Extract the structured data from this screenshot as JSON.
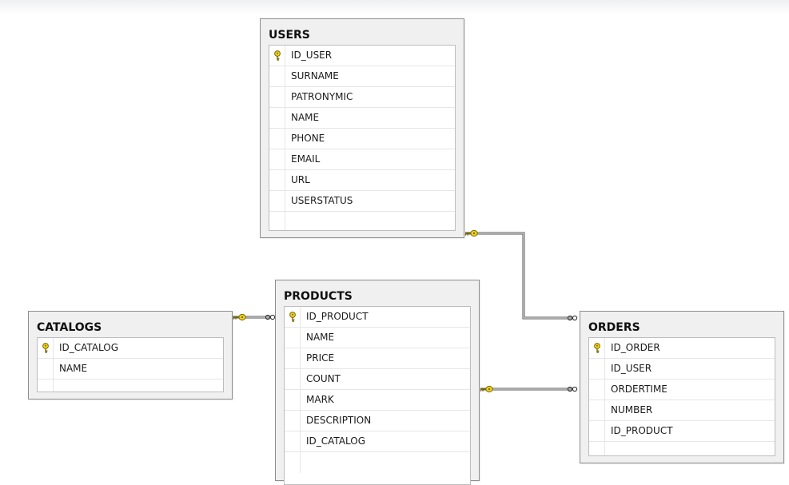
{
  "tables": {
    "users": {
      "name": "USERS",
      "columns": [
        {
          "name": "ID_USER",
          "primary_key": true
        },
        {
          "name": "SURNAME",
          "primary_key": false
        },
        {
          "name": "PATRONYMIC",
          "primary_key": false
        },
        {
          "name": "NAME",
          "primary_key": false
        },
        {
          "name": "PHONE",
          "primary_key": false
        },
        {
          "name": "EMAIL",
          "primary_key": false
        },
        {
          "name": "URL",
          "primary_key": false
        },
        {
          "name": "USERSTATUS",
          "primary_key": false
        }
      ]
    },
    "products": {
      "name": "PRODUCTS",
      "columns": [
        {
          "name": "ID_PRODUCT",
          "primary_key": true
        },
        {
          "name": "NAME",
          "primary_key": false
        },
        {
          "name": "PRICE",
          "primary_key": false
        },
        {
          "name": "COUNT",
          "primary_key": false
        },
        {
          "name": "MARK",
          "primary_key": false
        },
        {
          "name": "DESCRIPTION",
          "primary_key": false
        },
        {
          "name": "ID_CATALOG",
          "primary_key": false
        }
      ]
    },
    "catalogs": {
      "name": "CATALOGS",
      "columns": [
        {
          "name": "ID_CATALOG",
          "primary_key": true
        },
        {
          "name": "NAME",
          "primary_key": false
        }
      ]
    },
    "orders": {
      "name": "ORDERS",
      "columns": [
        {
          "name": "ID_ORDER",
          "primary_key": true
        },
        {
          "name": "ID_USER",
          "primary_key": false
        },
        {
          "name": "ORDERTIME",
          "primary_key": false
        },
        {
          "name": "NUMBER",
          "primary_key": false
        },
        {
          "name": "ID_PRODUCT",
          "primary_key": false
        }
      ]
    }
  },
  "relationships": [
    {
      "from": "USERS",
      "to": "ORDERS"
    },
    {
      "from": "CATALOGS",
      "to": "PRODUCTS"
    },
    {
      "from": "PRODUCTS",
      "to": "ORDERS"
    }
  ],
  "icons": {
    "primary_key": "key-icon",
    "one_end": "key-icon",
    "many_end": "infinity-icon"
  },
  "colors": {
    "key": "#f2d21a",
    "key_outline": "#7a6a08",
    "table_fill": "#f0f0f0",
    "table_border": "#8d8d8d",
    "connector": "#555555"
  }
}
